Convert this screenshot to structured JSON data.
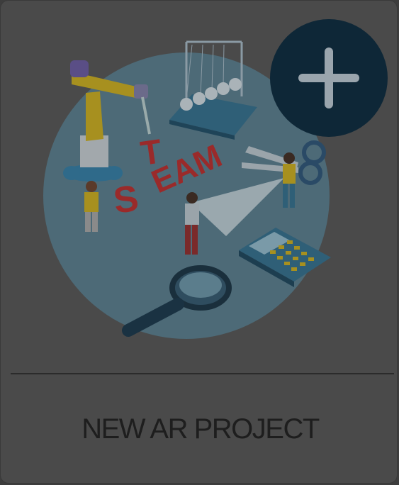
{
  "card": {
    "label": "NEW AR PROJECT",
    "add_button_icon": "plus-icon",
    "illustration_letters": "STEAM"
  },
  "colors": {
    "card_bg": "#4a4a4a",
    "illustration_disc": "#4d6a77",
    "plus_circle": "#0e2737",
    "plus_glyph": "#9aa5ad",
    "label_text": "#1e1e1e",
    "divider": "#2b2b2b"
  }
}
